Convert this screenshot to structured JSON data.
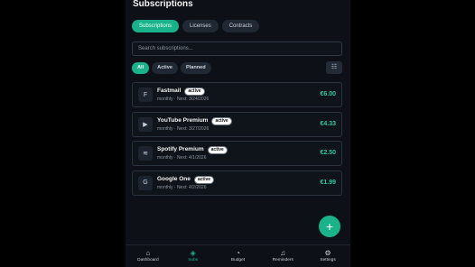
{
  "header": {
    "title": "Subscriptions"
  },
  "tabs": [
    {
      "label": "Subscriptions",
      "active": true
    },
    {
      "label": "Licenses",
      "active": false
    },
    {
      "label": "Contracts",
      "active": false
    }
  ],
  "search": {
    "placeholder": "Search subscriptions..."
  },
  "filters": [
    {
      "label": "All",
      "active": true
    },
    {
      "label": "Active",
      "active": false
    },
    {
      "label": "Planned",
      "active": false
    }
  ],
  "filter_icon": "sliders-icon",
  "items": [
    {
      "logo": "F",
      "name": "Fastmail",
      "badge": "active",
      "meta": "monthly · Next: 3/24/2026",
      "price": "€6.00"
    },
    {
      "logo": "▶",
      "name": "YouTube Premium",
      "badge": "active",
      "meta": "monthly · Next: 3/27/2026",
      "price": "€4.33"
    },
    {
      "logo": "≋",
      "name": "Spotify Premium",
      "badge": "active",
      "meta": "monthly · Next: 4/1/2026",
      "price": "€2.50"
    },
    {
      "logo": "G",
      "name": "Google One",
      "badge": "active",
      "meta": "monthly · Next: 4/2/2026",
      "price": "€1.99"
    }
  ],
  "fab": {
    "label": "+"
  },
  "nav": [
    {
      "icon": "⌂",
      "label": "Dashboard",
      "active": false
    },
    {
      "icon": "◈",
      "label": "Subs",
      "active": true
    },
    {
      "icon": "◔",
      "label": "Budget",
      "active": false
    },
    {
      "icon": "♫",
      "label": "Reminders",
      "active": false
    },
    {
      "icon": "⚙",
      "label": "Settings",
      "active": false
    }
  ],
  "colors": {
    "accent": "#19b28a",
    "price": "#2ec99c",
    "background": "#0d1117"
  }
}
